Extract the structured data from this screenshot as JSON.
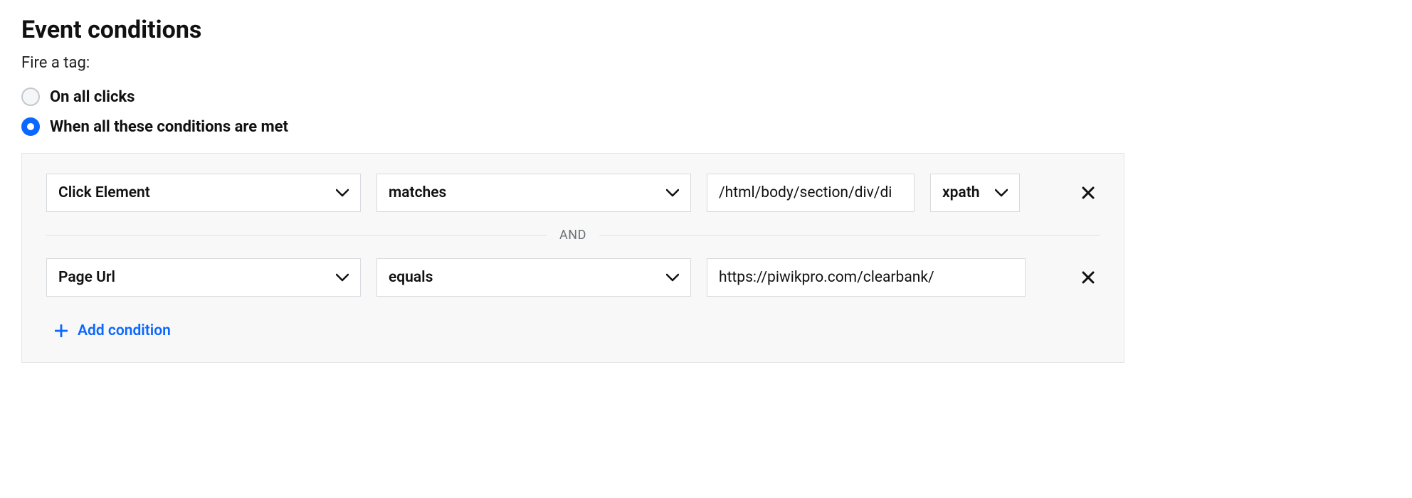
{
  "title": "Event conditions",
  "subtitle": "Fire a tag:",
  "radios": {
    "all_clicks": {
      "label": "On all clicks",
      "selected": false
    },
    "conditions": {
      "label": "When all these conditions are met",
      "selected": true
    }
  },
  "separator_label": "AND",
  "add_condition_label": "Add condition",
  "conditions_list": [
    {
      "variable": "Click Element",
      "operator": "matches",
      "value": "/html/body/section/div/di",
      "mode": "xpath",
      "has_mode": true
    },
    {
      "variable": "Page Url",
      "operator": "equals",
      "value": "https://piwikpro.com/clearbank/",
      "mode": "",
      "has_mode": false
    }
  ]
}
